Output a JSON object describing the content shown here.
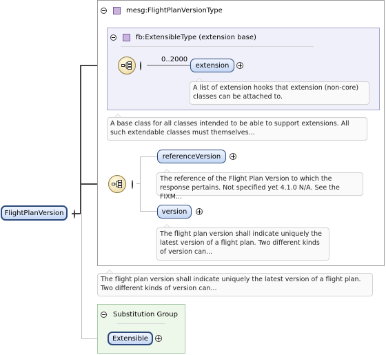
{
  "root": {
    "label": "FlightPlanVersion"
  },
  "type_panel": {
    "title": "mesg:FlightPlanVersionType"
  },
  "base_panel": {
    "title": "fb:ExtensibleType (extension base)",
    "cardinality": "0..2000",
    "extension": {
      "label": "extension",
      "note": "A list of extension hooks that extension (non-core) classes can be attached to."
    }
  },
  "base_note": "A base class for all classes intended to be able to support extensions. All such extendable classes must themselves...",
  "elements": [
    {
      "label": "referenceVersion",
      "note": "The reference of the Flight Plan Version to which the response pertains. Not specified yet 4.1.0 N/A. See the FIXM..."
    },
    {
      "label": "version",
      "note": "The flight plan version shall indicate uniquely the latest version of a flight plan. Two different kinds of version can..."
    }
  ],
  "root_note": "The flight plan version shall indicate uniquely the latest version of a flight plan. Two different kinds of version can...",
  "substitution_group": {
    "title": "Substitution Group",
    "member": "Extensible"
  },
  "colors": {
    "node_fill": "#c6d8f5",
    "node_border": "#2b4a7a",
    "base_panel_fill": "#f0f0fa",
    "subst_panel_fill": "#eef8ea",
    "compositor_fill": "#ecd79a"
  },
  "icons": [
    "collapse-icon",
    "expand-icon",
    "type-icon",
    "sequence-compositor-icon"
  ]
}
